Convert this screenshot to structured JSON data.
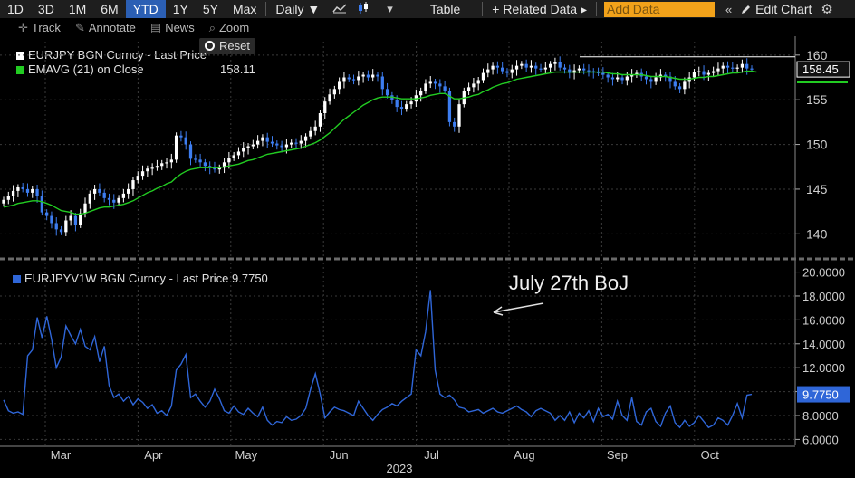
{
  "toolbar": {
    "ranges": [
      "1D",
      "3D",
      "1M",
      "6M",
      "YTD",
      "1Y",
      "5Y",
      "Max"
    ],
    "active_range": "YTD",
    "period": "Daily ▼",
    "table_label": "Table",
    "related_label": "+ Related Data ▸",
    "add_data_placeholder": "Add Data",
    "edit_label": "Edit Chart",
    "collapse_icon": "«",
    "edit_icon": "pencil-icon",
    "settings_icon": "gear-icon"
  },
  "subbar": {
    "track": "Track",
    "annotate": "Annotate",
    "news": "News",
    "zoom": "Zoom",
    "reset": "Reset"
  },
  "colors": {
    "candle_up": "#ffffff",
    "candle_down": "#3d7df0",
    "ema": "#22cc22",
    "vol_line": "#2f66d8",
    "last_price_box": "#2f66d8",
    "toolbar_accent": "#2b5fb4",
    "add_data_bg": "#f2a21a"
  },
  "chart_data": [
    {
      "type": "candlestick",
      "legend": [
        {
          "name": "EURJPY BGN Curncy - Last Price",
          "value": "158.45",
          "color": "#ffffff"
        },
        {
          "name": "EMAVG (21)  on Close",
          "value": "158.11",
          "color": "#22cc22"
        }
      ],
      "ylim": [
        137.5,
        161.5
      ],
      "y_ticks": [
        140,
        145,
        150,
        155,
        160
      ],
      "last_price_label": "158.45",
      "ema_label": "158.11",
      "reference_line": 159.8,
      "y_close": [
        143.8,
        144.2,
        144.8,
        145.2,
        145.0,
        144.6,
        145.0,
        144.2,
        142.4,
        142.0,
        141.2,
        140.5,
        140.2,
        141.5,
        142.0,
        141.0,
        142.3,
        143.4,
        144.5,
        145.0,
        144.6,
        144.0,
        143.8,
        143.5,
        144.0,
        144.5,
        145.0,
        146.0,
        146.5,
        147.0,
        147.3,
        147.4,
        147.6,
        147.9,
        148.0,
        148.3,
        151.0,
        150.8,
        150.0,
        148.4,
        148.3,
        148.0,
        147.6,
        147.4,
        147.2,
        147.4,
        148.0,
        148.5,
        148.8,
        149.2,
        149.6,
        149.8,
        150.0,
        150.4,
        150.8,
        150.3,
        150.1,
        149.9,
        149.7,
        150.0,
        150.2,
        150.1,
        150.4,
        150.9,
        151.5,
        152.0,
        153.5,
        154.8,
        155.6,
        156.2,
        157.0,
        157.5,
        157.3,
        157.2,
        157.6,
        157.8,
        157.5,
        157.8,
        157.6,
        156.2,
        155.5,
        155.0,
        154.2,
        154.0,
        154.5,
        154.8,
        155.5,
        156.0,
        156.8,
        157.0,
        156.8,
        156.5,
        156.0,
        152.5,
        152.0,
        154.5,
        156.0,
        156.4,
        156.8,
        157.2,
        158.0,
        158.4,
        158.8,
        158.6,
        158.2,
        158.0,
        158.4,
        158.8,
        159.0,
        158.6,
        158.8,
        158.5,
        158.4,
        158.6,
        159.0,
        159.2,
        158.6,
        158.4,
        158.0,
        158.3,
        158.5,
        158.3,
        158.2,
        158.1,
        158.0,
        157.8,
        157.5,
        157.3,
        157.5,
        157.2,
        157.6,
        157.8,
        158.0,
        157.6,
        157.3,
        157.0,
        157.5,
        157.8,
        157.6,
        157.0,
        156.5,
        156.2,
        157.0,
        157.5,
        158.1,
        158.2,
        157.8,
        158.0,
        158.2,
        158.5,
        158.8,
        158.6,
        158.5,
        158.6,
        159.0,
        158.5,
        158.45
      ],
      "y_ema": [
        143.0,
        143.1,
        143.2,
        143.4,
        143.5,
        143.6,
        143.7,
        143.7,
        143.6,
        143.4,
        143.2,
        142.9,
        142.6,
        142.5,
        142.4,
        142.2,
        142.2,
        142.3,
        142.5,
        142.7,
        142.9,
        143.0,
        143.0,
        143.1,
        143.2,
        143.3,
        143.5,
        143.7,
        144.0,
        144.3,
        144.6,
        144.8,
        145.1,
        145.3,
        145.6,
        145.8,
        146.3,
        146.7,
        147.0,
        147.2,
        147.3,
        147.4,
        147.4,
        147.4,
        147.4,
        147.4,
        147.5,
        147.6,
        147.7,
        147.8,
        148.0,
        148.2,
        148.3,
        148.5,
        148.7,
        148.9,
        149.0,
        149.1,
        149.2,
        149.3,
        149.4,
        149.5,
        149.6,
        149.8,
        150.0,
        150.2,
        150.5,
        150.9,
        151.3,
        151.8,
        152.3,
        152.8,
        153.2,
        153.6,
        154.0,
        154.4,
        154.7,
        155.0,
        155.2,
        155.3,
        155.3,
        155.3,
        155.2,
        155.1,
        155.1,
        155.1,
        155.1,
        155.2,
        155.3,
        155.5,
        155.6,
        155.7,
        155.7,
        155.4,
        155.1,
        155.1,
        155.2,
        155.3,
        155.5,
        155.6,
        155.9,
        156.1,
        156.4,
        156.6,
        156.8,
        156.9,
        157.1,
        157.3,
        157.4,
        157.5,
        157.6,
        157.7,
        157.8,
        157.9,
        158.0,
        158.1,
        158.1,
        158.1,
        158.1,
        158.1,
        158.1,
        158.1,
        158.1,
        158.1,
        158.1,
        158.1,
        158.0,
        157.9,
        157.9,
        157.8,
        157.8,
        157.8,
        157.8,
        157.8,
        157.7,
        157.6,
        157.6,
        157.6,
        157.6,
        157.5,
        157.4,
        157.3,
        157.3,
        157.3,
        157.4,
        157.5,
        157.5,
        157.6,
        157.6,
        157.7,
        157.8,
        157.9,
        158.0,
        158.0,
        158.1,
        158.2,
        158.2,
        158.11
      ]
    },
    {
      "type": "line",
      "legend": [
        {
          "name": "EURJPYV1W BGN Curncy - Last Price",
          "value": "9.7750",
          "color": "#2f66d8"
        }
      ],
      "ylim": [
        5.5,
        20.8
      ],
      "y_ticks": [
        6.0,
        8.0,
        10.0,
        12.0,
        14.0,
        16.0,
        18.0,
        20.0
      ],
      "y_tick_labels": [
        "6.0000",
        "8.0000",
        "10.0000",
        "12.0000",
        "14.0000",
        "16.0000",
        "18.0000",
        "20.0000"
      ],
      "last_value_label": "9.7750",
      "y": [
        9.3,
        8.4,
        8.2,
        8.3,
        8.1,
        13.0,
        13.5,
        16.2,
        14.5,
        16.3,
        14.4,
        12.0,
        12.9,
        15.5,
        14.7,
        14.0,
        15.2,
        13.8,
        13.5,
        14.6,
        12.5,
        13.8,
        10.5,
        9.5,
        9.8,
        9.2,
        9.6,
        8.9,
        9.4,
        9.1,
        8.6,
        8.9,
        8.2,
        8.4,
        8.0,
        8.8,
        11.8,
        12.3,
        13.1,
        9.5,
        9.8,
        9.2,
        8.7,
        9.2,
        10.2,
        9.4,
        8.4,
        8.2,
        8.8,
        8.3,
        8.1,
        8.6,
        8.2,
        7.9,
        8.7,
        7.6,
        7.2,
        7.5,
        7.4,
        7.9,
        7.6,
        7.7,
        8.0,
        8.6,
        10.2,
        11.5,
        9.8,
        7.8,
        8.3,
        8.7,
        8.5,
        8.4,
        8.2,
        8.0,
        9.2,
        8.6,
        8.0,
        7.6,
        8.1,
        8.5,
        8.7,
        9.0,
        8.8,
        9.2,
        9.5,
        9.8,
        13.5,
        13.0,
        15.0,
        18.5,
        11.8,
        9.8,
        9.5,
        9.7,
        9.3,
        8.7,
        8.6,
        8.3,
        8.4,
        8.5,
        8.2,
        8.4,
        8.6,
        8.3,
        8.2,
        8.4,
        8.6,
        8.8,
        8.5,
        8.3,
        7.9,
        8.4,
        8.6,
        8.4,
        8.2,
        7.6,
        8.0,
        7.6,
        8.3,
        7.4,
        8.2,
        7.8,
        8.4,
        7.5,
        8.6,
        7.9,
        8.1,
        7.7,
        9.2,
        8.0,
        7.6,
        9.5,
        7.5,
        7.2,
        8.3,
        8.6,
        7.5,
        7.1,
        8.2,
        8.8,
        7.4,
        7.0,
        7.6,
        7.1,
        7.4,
        8.0,
        7.5,
        7.0,
        7.2,
        7.8,
        7.6,
        7.2,
        8.0,
        9.0,
        7.8,
        9.7,
        9.775
      ]
    }
  ],
  "x_axis": {
    "months": [
      "Mar",
      "Apr",
      "May",
      "Jun",
      "Jul",
      "Aug",
      "Sep",
      "Oct"
    ],
    "year": "2023"
  },
  "annotation": {
    "text": "July 27th BoJ"
  }
}
